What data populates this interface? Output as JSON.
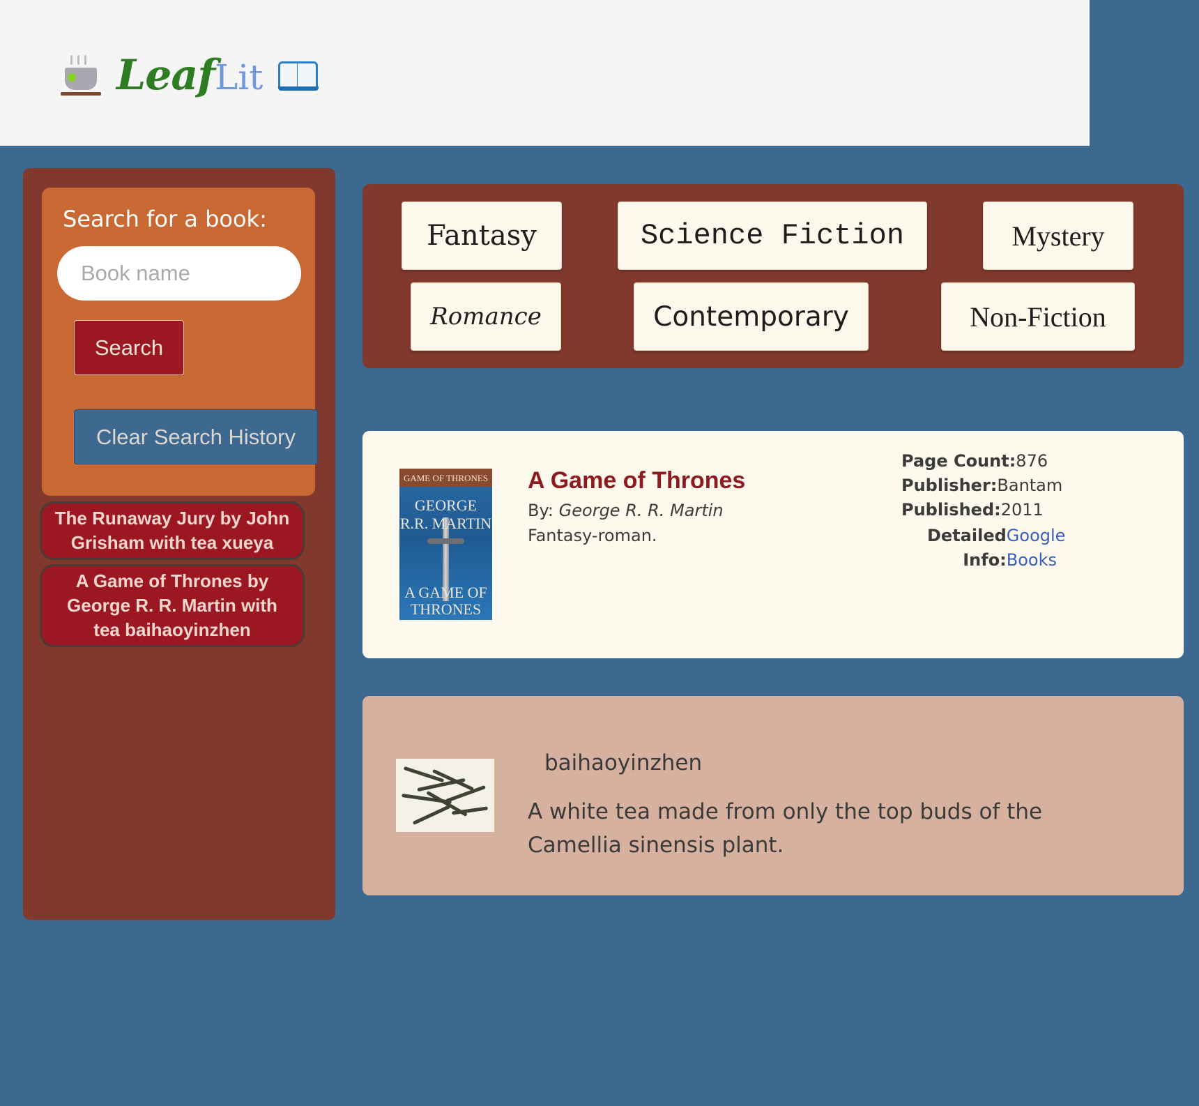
{
  "logo": {
    "part1": "Leaf",
    "part2": "Lit",
    "left_icon": "tea-cup-icon",
    "right_icon": "open-book-icon"
  },
  "sidebar": {
    "search_title": "Search for a book:",
    "search_placeholder": "Book name",
    "search_button": "Search",
    "clear_button": "Clear Search History",
    "history": [
      "The Runaway Jury by John Grisham with tea xueya",
      "A Game of Thrones by George R. R. Martin with tea baihaoyinzhen"
    ]
  },
  "genres": [
    "Fantasy",
    "Science Fiction",
    "Mystery",
    "Romance",
    "Contemporary",
    "Non-Fiction"
  ],
  "book": {
    "cover": {
      "series": "GAME OF THRONES",
      "author": "GEORGE R.R. MARTIN",
      "title": "A GAME OF THRONES"
    },
    "title": "A Game of Thrones",
    "by_label": "By:",
    "author": "George R. R. Martin",
    "description": "Fantasy-roman.",
    "page_count_label": "Page Count:",
    "page_count": "876",
    "publisher_label": "Publisher:",
    "publisher": "Bantam",
    "published_label": "Published:",
    "published": "2011",
    "detailed_label_1": "Detailed",
    "detailed_label_2": "Info:",
    "link_1": "Google",
    "link_2": "Books"
  },
  "tea": {
    "name": "baihaoyinzhen",
    "description": "A white tea made from only the top buds of the Camellia sinensis plant."
  },
  "colors": {
    "page_bg": "#3d6890",
    "header_bg": "#f5f5f5",
    "sidebar_bg": "#80392c",
    "search_box_bg": "#c86832",
    "accent_red": "#9b1822",
    "card_bg": "#fdf9ec",
    "tea_card_bg": "#d7b19f"
  }
}
